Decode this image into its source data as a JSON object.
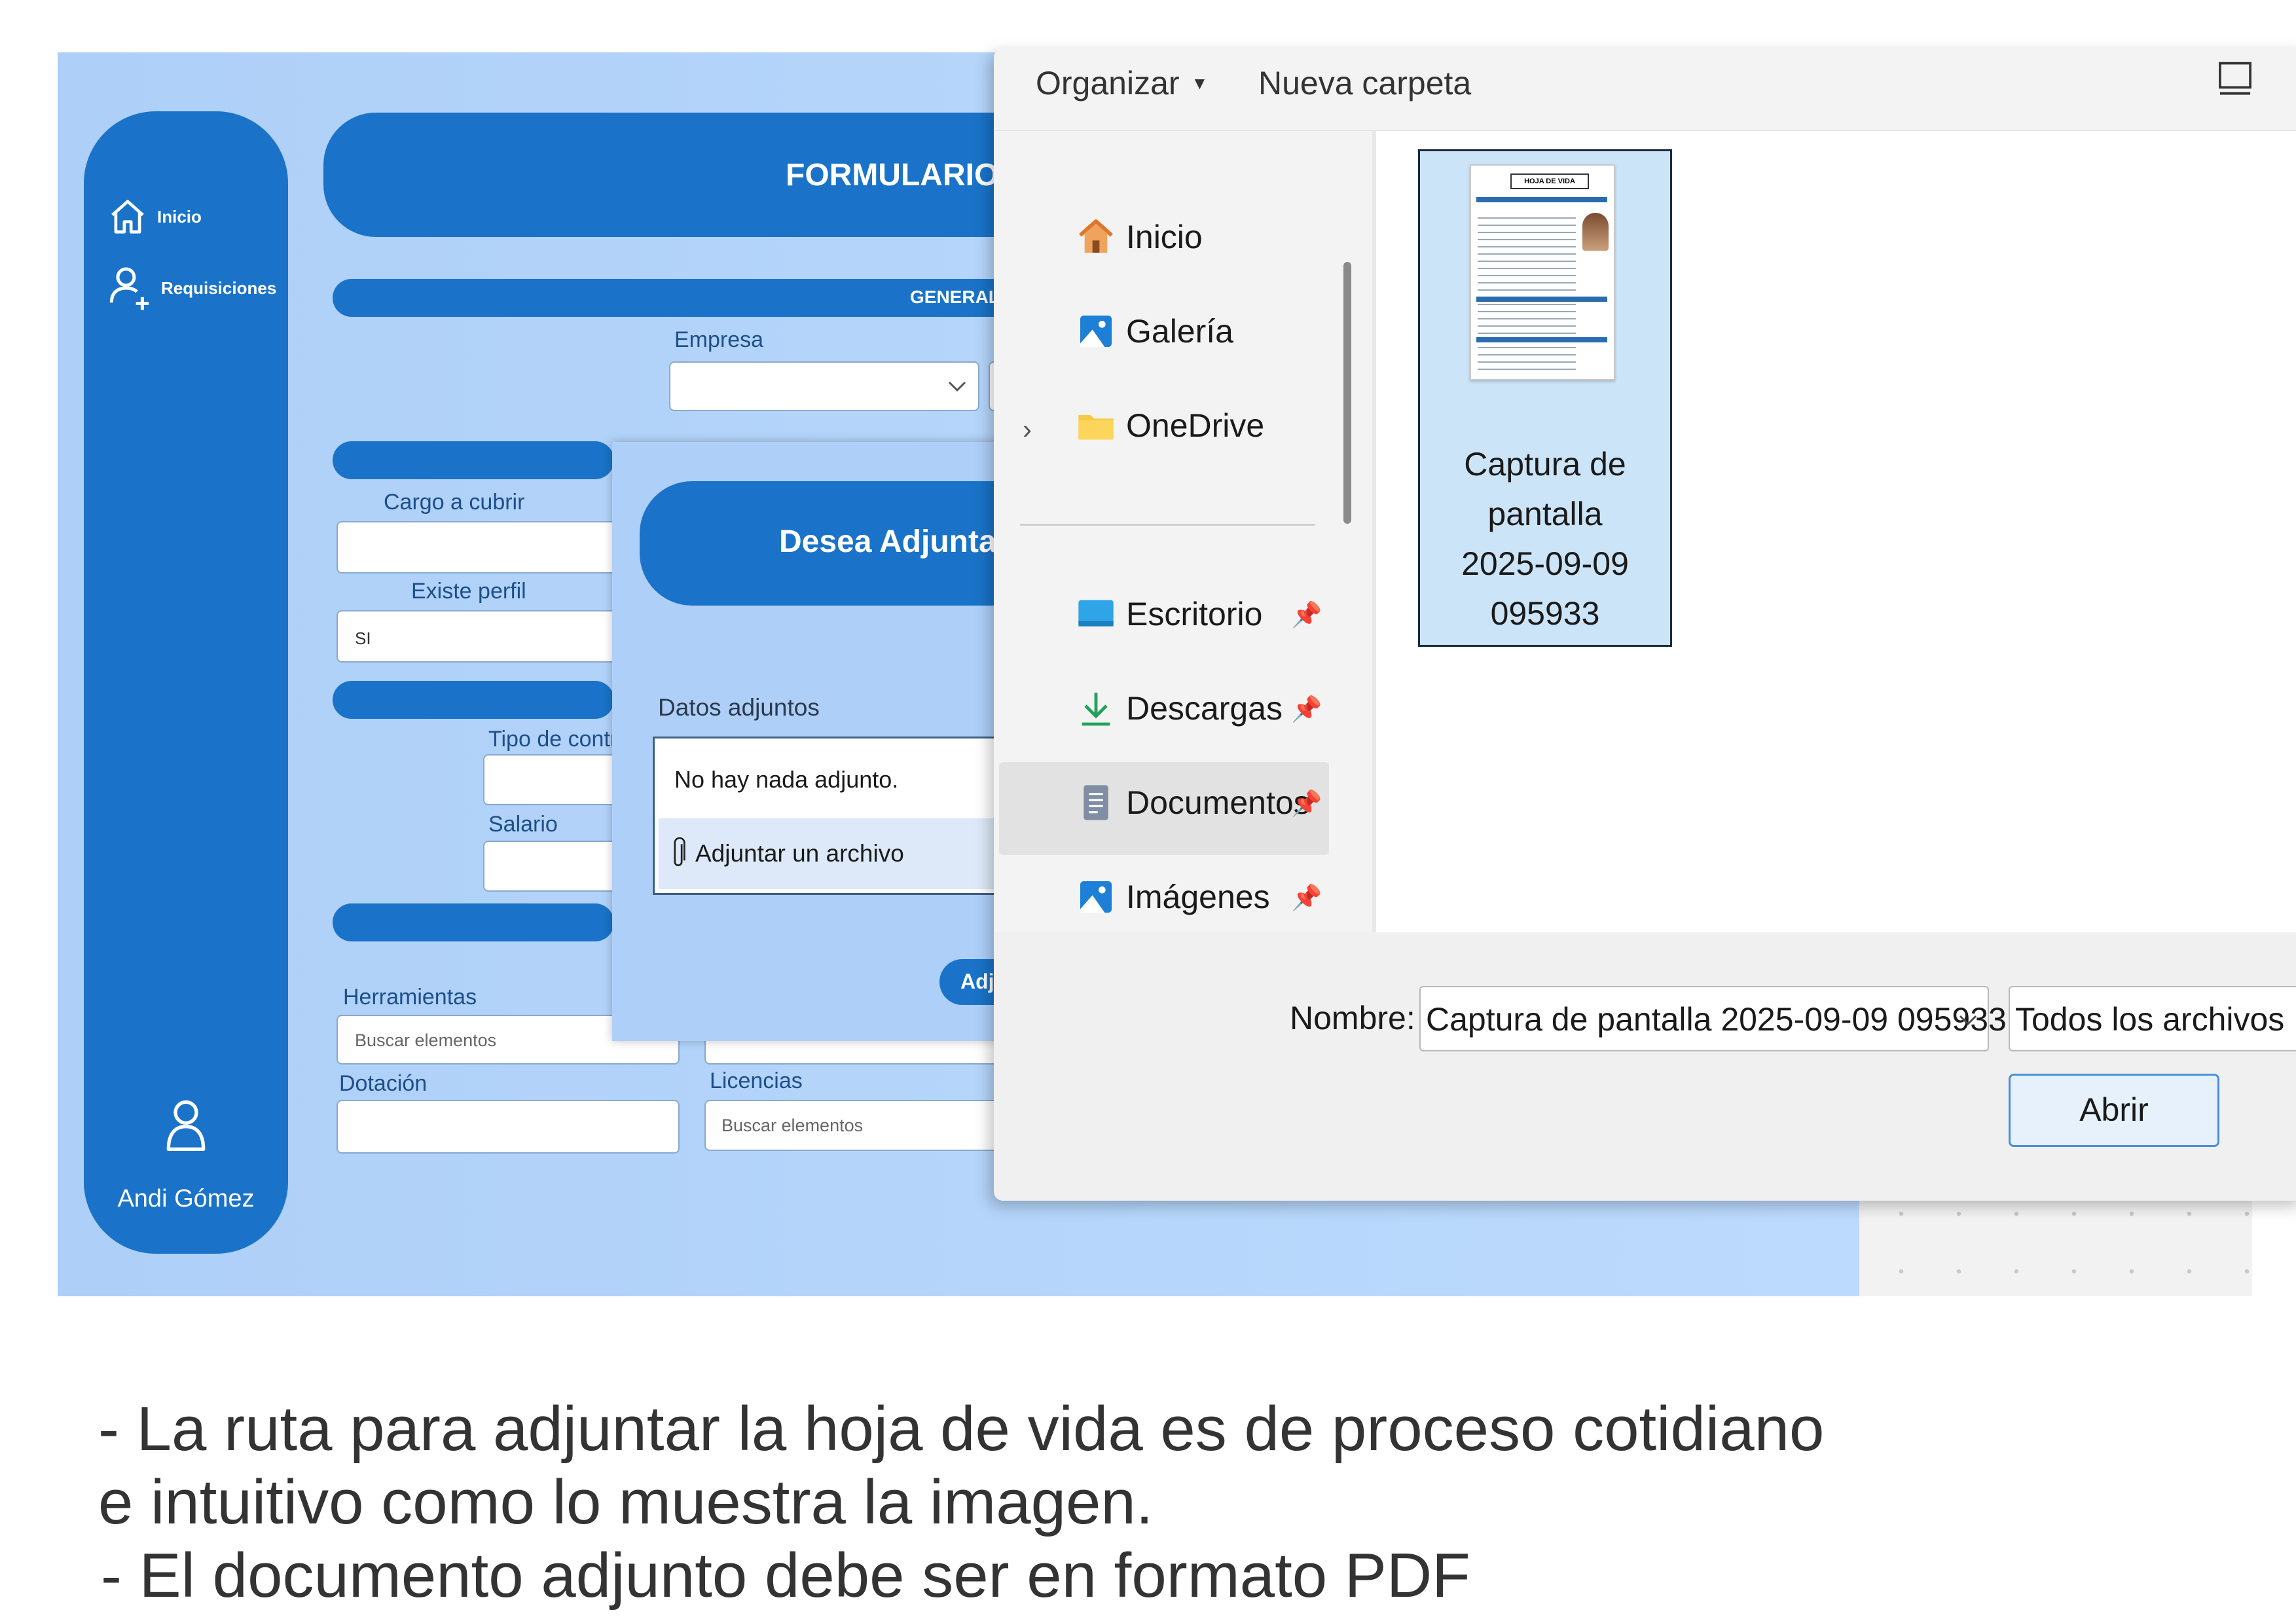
{
  "app": {
    "sidebar": {
      "items": [
        {
          "label": "Inicio",
          "icon": "home-icon"
        },
        {
          "label": "Requisiciones",
          "icon": "add-user-icon"
        }
      ],
      "user_name": "Andi Gómez"
    },
    "form_title": "FORMULARIO R",
    "section_generales": "GENERALE",
    "fields": {
      "empresa": "Empresa",
      "cargo": "Cargo a cubrir",
      "existe_perfil": "Existe perfil",
      "existe_perfil_value": "SI",
      "tipo_contrato": "Tipo de contr",
      "salario": "Salario",
      "herramientas": "Herramientas",
      "herramientas_placeholder": "Buscar elementos",
      "dotacion": "Dotación",
      "licencias": "Licencias",
      "licencias_placeholder": "Buscar elementos"
    }
  },
  "modal": {
    "title": "Desea Adjuntar H",
    "attachments_label": "Datos adjuntos",
    "no_attachments": "No hay nada adjunto.",
    "attach_file": "Adjuntar un archivo",
    "button": "Adju"
  },
  "file_dialog": {
    "toolbar": {
      "organize": "Organizar",
      "new_folder": "Nueva carpeta"
    },
    "nav": [
      {
        "label": "Inicio",
        "icon": "home-icon"
      },
      {
        "label": "Galería",
        "icon": "gallery-icon"
      },
      {
        "label": "OneDrive",
        "icon": "folder-icon"
      },
      {
        "label": "Escritorio",
        "icon": "desktop-icon"
      },
      {
        "label": "Descargas",
        "icon": "download-icon"
      },
      {
        "label": "Documentos",
        "icon": "document-icon"
      },
      {
        "label": "Imágenes",
        "icon": "image-icon"
      }
    ],
    "file": {
      "name_lines": [
        "Captura de",
        "pantalla",
        "2025-09-09",
        "095933"
      ],
      "thumb_title": "HOJA DE VIDA"
    },
    "name_label": "Nombre:",
    "name_value": "Captura de pantalla 2025-09-09 095933",
    "filter_value": "Todos los archivos",
    "open_button": "Abrir"
  },
  "caption": {
    "line1": "- La ruta para adjuntar la hoja de vida es de proceso cotidiano",
    "line2": "e intuitivo como lo muestra la imagen.",
    "line3": "- El documento adjunto debe ser en formato PDF"
  },
  "colors": {
    "primary": "#1a73c8",
    "app_bg": "#b6d6fb",
    "selection": "#cce4f7"
  }
}
